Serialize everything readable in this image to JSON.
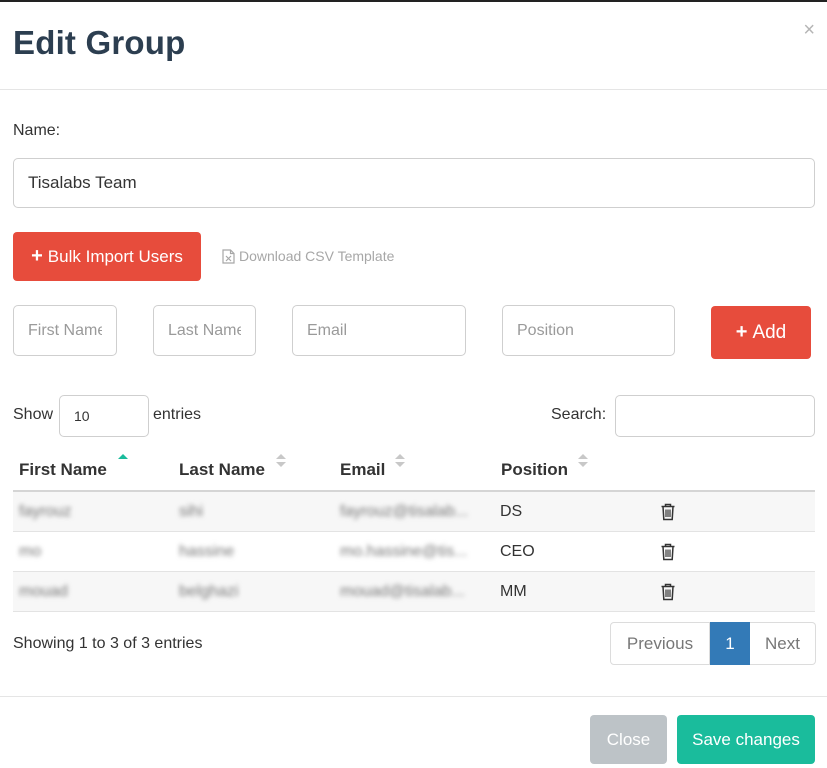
{
  "modal": {
    "title": "Edit Group",
    "close_symbol": "×"
  },
  "form": {
    "name_label": "Name:",
    "name_value": "Tisalabs Team",
    "bulk_import_label": "Bulk Import Users",
    "download_label": "Download CSV Template",
    "first_name_placeholder": "First Name",
    "last_name_placeholder": "Last Name",
    "email_placeholder": "Email",
    "position_placeholder": "Position",
    "add_label": "Add"
  },
  "table_controls": {
    "show_label": "Show",
    "entries_value": "10",
    "entries_label": "entries",
    "search_label": "Search:",
    "search_value": ""
  },
  "table": {
    "columns": [
      "First Name",
      "Last Name",
      "Email",
      "Position"
    ],
    "rows": [
      {
        "first": "fayrouz",
        "last": "sihi",
        "email": "fayrouz@tisalab...",
        "position": "DS"
      },
      {
        "first": "mo",
        "last": "hassine",
        "email": "mo.hassine@tis...",
        "position": "CEO"
      },
      {
        "first": "mouad",
        "last": "belghazi",
        "email": "mouad@tisalab...",
        "position": "MM"
      }
    ]
  },
  "pagination": {
    "info": "Showing 1 to 3 of 3 entries",
    "previous": "Previous",
    "current": "1",
    "next": "Next"
  },
  "footer": {
    "close_label": "Close",
    "save_label": "Save changes"
  },
  "colors": {
    "primary_red": "#e74c3c",
    "save_teal": "#1abc9c",
    "close_gray": "#bdc3c7",
    "page_active": "#337ab7",
    "sort_active": "#1abc9c"
  },
  "icons": {
    "plus": "plus-icon",
    "file_excel": "file-excel-icon",
    "trash": "trash-icon",
    "sort": "sort-icon"
  }
}
